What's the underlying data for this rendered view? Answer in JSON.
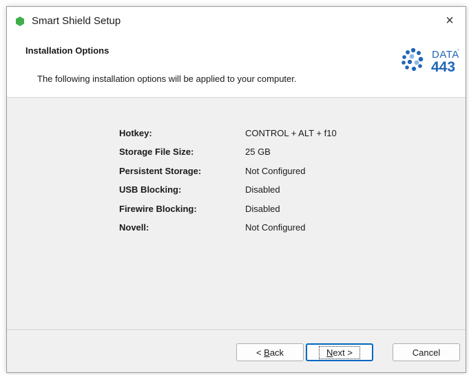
{
  "window": {
    "title": "Smart Shield Setup",
    "close_glyph": "×"
  },
  "banner": {
    "title": "Installation Options",
    "subtitle": "The following installation options will be applied to your computer.",
    "logo": {
      "top": "DATA",
      "bottom": "443",
      "mark": "°"
    }
  },
  "options": [
    {
      "label": "Hotkey:",
      "value": "CONTROL + ALT + f10"
    },
    {
      "label": "Storage File Size:",
      "value": "25 GB"
    },
    {
      "label": "Persistent Storage:",
      "value": "Not Configured"
    },
    {
      "label": "USB Blocking:",
      "value": "Disabled"
    },
    {
      "label": "Firewire Blocking:",
      "value": "Disabled"
    },
    {
      "label": "Novell:",
      "value": "Not Configured"
    }
  ],
  "buttons": {
    "back": {
      "prefix": "< ",
      "mnemonic": "B",
      "rest": "ack"
    },
    "next": {
      "mnemonic": "N",
      "rest": "ext >"
    },
    "cancel": "Cancel"
  },
  "colors": {
    "logo_blue": "#1f66b5",
    "app_icon_green": "#3fae4a",
    "accent": "#0067c0"
  }
}
